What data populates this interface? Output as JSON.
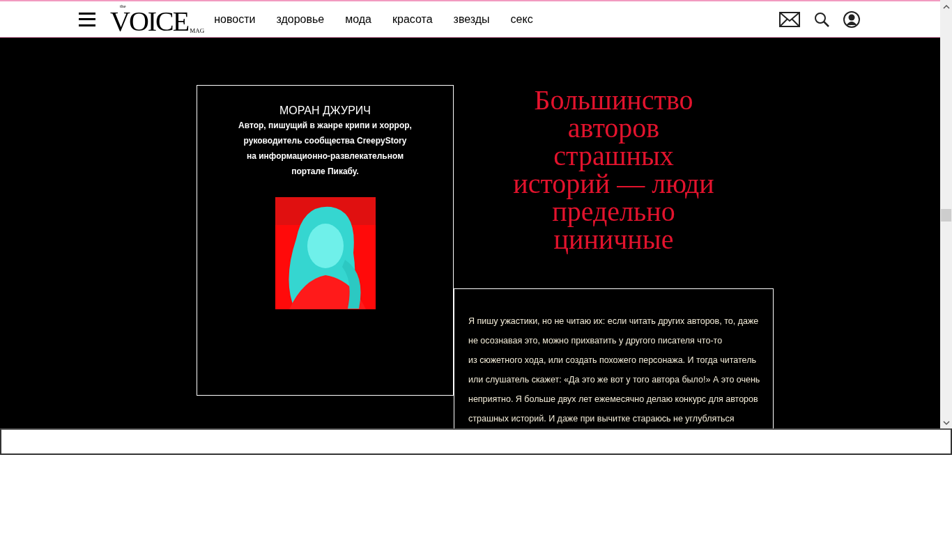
{
  "header": {
    "logo": {
      "small_top": "the",
      "name": "VOICE",
      "small_bottom": "MAG"
    },
    "nav": [
      {
        "label": "новости"
      },
      {
        "label": "здоровье"
      },
      {
        "label": "мода"
      },
      {
        "label": "красота"
      },
      {
        "label": "звезды"
      },
      {
        "label": "секс"
      }
    ]
  },
  "author_card": {
    "name": "МОРАН ДЖУРИЧ",
    "bio": [
      "Автор, пишущий в жанре крипи и хоррор,",
      "руководитель сообщества CreepyStory",
      "на информационно-развлекательном",
      "портале Пикабу."
    ]
  },
  "headline": [
    "Большинство",
    "авторов",
    "страшных",
    "историй — люди",
    "предельно",
    "циничные"
  ],
  "quote": [
    "Я пишу ужастики, но не читаю их: если читать других авторов, то, даже",
    "не осознавая это, можно прихватить у другого писателя что-то",
    "из сюжетного хода, или создать похожего персонажа. И тогда читатель",
    "или слушатель скажет: «Да это же вот у того автора было!» А это очень",
    "неприятно. Я больше двух лет ежемесячно делаю конкурс для авторов",
    "страшных историй. И даже при вычитке стараюсь не углубляться"
  ]
}
